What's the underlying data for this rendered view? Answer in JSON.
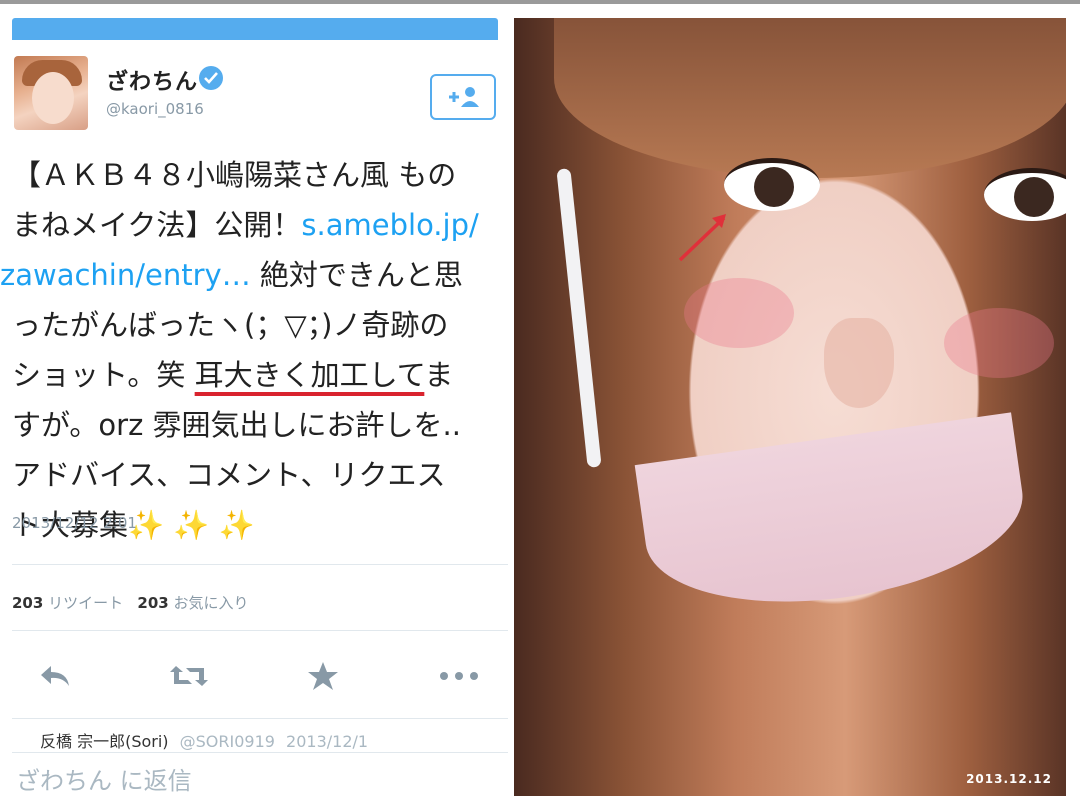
{
  "tweet": {
    "display_name": "ざわちん",
    "screen_name": "@kaori_0816",
    "text_lines": [
      "【ＡＫＢ４８小嶋陽菜さん風 もの",
      "まねメイク法】公開！",
      "s.ameblo.jp/",
      "zawachin/entry…",
      " 絶対できんと思",
      "ったがんばったヽ(；▽；)ノ奇跡の",
      "ショット。笑 ",
      "耳大きく加工して",
      "ま",
      "すが。orz 雰囲気出しにお許しを..",
      "アドバイス、コメント、リクエス",
      "ト大募集",
      "✨ ✨ ✨"
    ],
    "timestamp": "2013/12/12 2:01",
    "retweet_count": "203",
    "retweet_label": "リツイート",
    "favorite_count": "203",
    "favorite_label": "お気に入り",
    "reply_author_name": "反橋 宗一郎(Sori)",
    "reply_author_handle": "@SORI0919",
    "reply_author_date": "2013/12/1",
    "reply_placeholder": "ざわちん に返信"
  },
  "photo": {
    "date_stamp": "2013.12.12"
  },
  "colors": {
    "twitter_blue": "#55acee",
    "link_blue": "#1da1f2",
    "underline_red": "#d9232e",
    "arrow_red": "#e0303a"
  }
}
